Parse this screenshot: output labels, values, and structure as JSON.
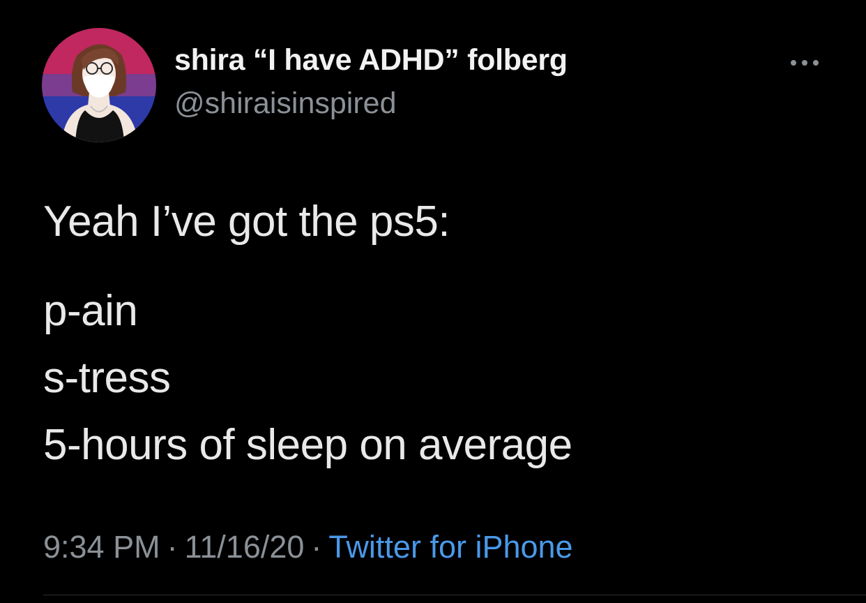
{
  "tweet": {
    "display_name": "shira “I have ADHD” folberg",
    "handle": "@shiraisinspired",
    "more_icon": "more-horizontal-icon",
    "lines": [
      "Yeah I’ve got the ps5:",
      "p-ain",
      "s-tress",
      "5-hours of sleep on average"
    ],
    "time": "9:34 PM",
    "separator": "·",
    "date": "11/16/20",
    "source": "Twitter for iPhone"
  },
  "colors": {
    "background": "#000000",
    "name_text": "#f2f2f2",
    "secondary_text": "#8b9197",
    "link_blue": "#4a99e9",
    "avatar_flag_pink": "#c0285f",
    "avatar_flag_purple": "#7a3d8f",
    "avatar_flag_blue": "#2d3aa8"
  }
}
